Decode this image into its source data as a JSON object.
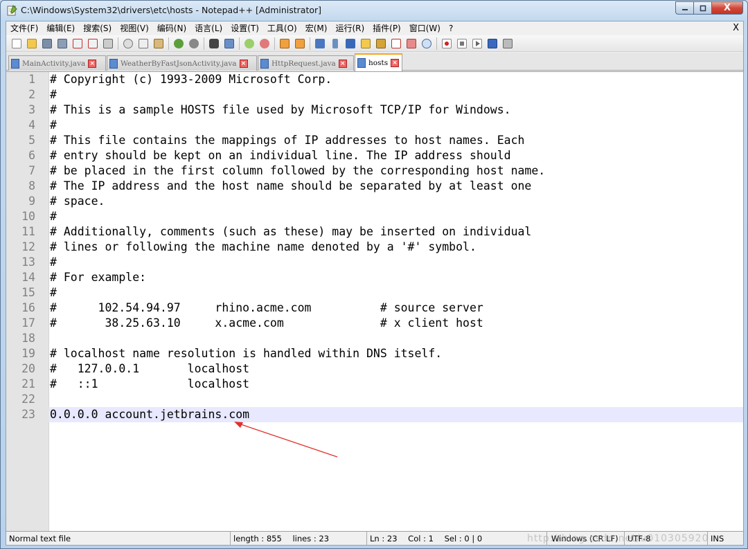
{
  "window": {
    "title": "C:\\Windows\\System32\\drivers\\etc\\hosts - Notepad++ [Administrator]",
    "close_glyph": "X"
  },
  "menu": {
    "items": [
      "文件(F)",
      "编辑(E)",
      "搜索(S)",
      "视图(V)",
      "编码(N)",
      "语言(L)",
      "设置(T)",
      "工具(O)",
      "宏(M)",
      "运行(R)",
      "插件(P)",
      "窗口(W)",
      "?"
    ],
    "close_label": "X"
  },
  "toolbar": {
    "icons": [
      "new-file",
      "open-file",
      "save",
      "save-all",
      "close",
      "close-all",
      "print",
      "cut",
      "copy",
      "paste",
      "undo",
      "redo",
      "find",
      "replace",
      "zoom-in",
      "zoom-out",
      "sync-vertical",
      "sync-horizontal",
      "word-wrap",
      "show-all-chars",
      "indent-guide",
      "user-language",
      "doc-map",
      "function-list",
      "folder-as-workspace",
      "monitor",
      "record-macro",
      "stop-record",
      "play-macro",
      "run-macro-multiple",
      "save-macro"
    ]
  },
  "tabs": [
    {
      "label": "MainActivity.java",
      "active": false
    },
    {
      "label": "WeatherByFastJsonActivity.java",
      "active": false
    },
    {
      "label": "HttpRequest.java",
      "active": false
    },
    {
      "label": "hosts",
      "active": true
    }
  ],
  "editor": {
    "current_line": 23,
    "lines": [
      {
        "n": "1",
        "text": "# Copyright (c) 1993-2009 Microsoft Corp."
      },
      {
        "n": "2",
        "text": "#"
      },
      {
        "n": "3",
        "text": "# This is a sample HOSTS file used by Microsoft TCP/IP for Windows."
      },
      {
        "n": "4",
        "text": "#"
      },
      {
        "n": "5",
        "text": "# This file contains the mappings of IP addresses to host names. Each"
      },
      {
        "n": "6",
        "text": "# entry should be kept on an individual line. The IP address should"
      },
      {
        "n": "7",
        "text": "# be placed in the first column followed by the corresponding host name."
      },
      {
        "n": "8",
        "text": "# The IP address and the host name should be separated by at least one"
      },
      {
        "n": "9",
        "text": "# space."
      },
      {
        "n": "10",
        "text": "#"
      },
      {
        "n": "11",
        "text": "# Additionally, comments (such as these) may be inserted on individual"
      },
      {
        "n": "12",
        "text": "# lines or following the machine name denoted by a '#' symbol."
      },
      {
        "n": "13",
        "text": "#"
      },
      {
        "n": "14",
        "text": "# For example:"
      },
      {
        "n": "15",
        "text": "#"
      },
      {
        "n": "16",
        "text": "#      102.54.94.97     rhino.acme.com          # source server"
      },
      {
        "n": "17",
        "text": "#       38.25.63.10     x.acme.com              # x client host"
      },
      {
        "n": "18",
        "text": ""
      },
      {
        "n": "19",
        "text": "# localhost name resolution is handled within DNS itself."
      },
      {
        "n": "20",
        "text": "#   127.0.0.1       localhost"
      },
      {
        "n": "21",
        "text": "#   ::1             localhost"
      },
      {
        "n": "22",
        "text": ""
      },
      {
        "n": "23",
        "text": "0.0.0.0 account.jetbrains.com"
      }
    ]
  },
  "statusbar": {
    "file_type": "Normal text file",
    "length": "length : 855",
    "lines": "lines : 23",
    "ln": "Ln : 23",
    "col": "Col : 1",
    "sel": "Sel : 0 | 0",
    "eol": "Windows (CR LF)",
    "encoding": "UTF-8",
    "mode": "INS",
    "watermark": "http://blog.csdn.net/u010305920"
  },
  "colors": {
    "current_line": "#e8e8ff",
    "annotation_arrow": "#e0302a",
    "active_tab_accent": "#f5a623"
  }
}
